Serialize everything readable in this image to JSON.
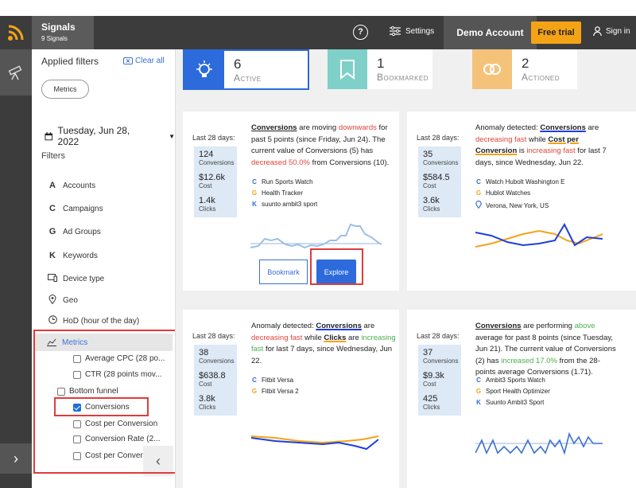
{
  "app": {
    "title": "Signals",
    "subtitle": "9 Signals"
  },
  "topbar": {
    "help": "?",
    "settings": "Settings",
    "account": "Demo Account",
    "trial": "Free trial",
    "signin": "Sign in"
  },
  "sidebar": {
    "applied_filters": "Applied filters",
    "clear_all": "Clear all",
    "pill": "Metrics",
    "date": "Tuesday, Jun 28, 2022",
    "filters_title": "Filters",
    "filters": [
      {
        "icon": "A",
        "label": "Accounts"
      },
      {
        "icon": "C",
        "label": "Campaigns"
      },
      {
        "icon": "G",
        "label": "Ad Groups"
      },
      {
        "icon": "K",
        "label": "Keywords"
      },
      {
        "icon": "device",
        "label": "Device type"
      },
      {
        "icon": "pin",
        "label": "Geo"
      },
      {
        "icon": "clock",
        "label": "HoD (hour of the day)"
      }
    ],
    "metrics": "Metrics",
    "checkboxes": [
      {
        "label": "Average CPC (28 po...",
        "checked": false
      },
      {
        "label": "CTR (28 points mov...",
        "checked": false
      },
      {
        "label": "Bottom funnel",
        "checked": false
      },
      {
        "label": "Conversions",
        "checked": true
      },
      {
        "label": "Cost per Conversion",
        "checked": false
      },
      {
        "label": "Conversion Rate (2...",
        "checked": false
      },
      {
        "label": "Cost per Conversi",
        "checked": false
      }
    ]
  },
  "stats": [
    {
      "value": "6",
      "label": "Active",
      "color": "#2d6bdc"
    },
    {
      "value": "1",
      "label": "Bookmarked",
      "color": "#7ed0c8"
    },
    {
      "value": "2",
      "label": "Actioned",
      "color": "#f5c27a"
    }
  ],
  "cards": [
    {
      "period": "Last 28 days:",
      "kpis": [
        {
          "v": "124",
          "k": "Conversions"
        },
        {
          "v": "$12.6k",
          "k": "Cost"
        },
        {
          "v": "1.4k",
          "k": "Clicks"
        }
      ],
      "t": [
        "Conversions",
        " are moving ",
        "downwards",
        " for past 5 points (since Friday, Jun 24). The current value of Conversions (5) has ",
        "decreased 50.0%",
        " from Conversions (10)."
      ],
      "items": [
        {
          "i": "C",
          "n": "Run Sports Watch"
        },
        {
          "i": "G",
          "n": "Health Tracker"
        },
        {
          "i": "K",
          "n": "suunto ambit3 sport"
        }
      ],
      "bookmark": "Bookmark",
      "explore": "Explore"
    },
    {
      "period": "Last 28 days:",
      "kpis": [
        {
          "v": "35",
          "k": "Conversions"
        },
        {
          "v": "$584.5",
          "k": "Cost"
        },
        {
          "v": "3.6k",
          "k": "Clicks"
        }
      ],
      "t": [
        "Anomaly detected: ",
        "Conversions",
        " are ",
        "decreasing fast",
        " while ",
        "Cost per Conversion",
        " is ",
        "increasing fast",
        " for last 7 days, since Wednesday, Jun 22."
      ],
      "items": [
        {
          "i": "C",
          "n": "Watch Hubolt Washington E"
        },
        {
          "i": "G",
          "n": "Hublot Watches"
        },
        {
          "i": "pin",
          "n": "Verona, New York, US"
        }
      ]
    },
    {
      "period": "Last 28 days:",
      "kpis": [
        {
          "v": "38",
          "k": "Conversions"
        },
        {
          "v": "$638.8",
          "k": "Cost"
        },
        {
          "v": "3.8k",
          "k": "Clicks"
        }
      ],
      "t": [
        "Anomaly detected: ",
        "Conversions",
        " are ",
        "decreasing fast",
        " while ",
        "Clicks",
        " are ",
        "increasing fast",
        " for last 7 days, since Wednesday, Jun 22."
      ],
      "items": [
        {
          "i": "C",
          "n": "Fitbit Versa"
        },
        {
          "i": "G",
          "n": "Fitbit Versa 2"
        }
      ]
    },
    {
      "period": "Last 28 days:",
      "kpis": [
        {
          "v": "37",
          "k": "Conversions"
        },
        {
          "v": "$9.3k",
          "k": "Cost"
        },
        {
          "v": "425",
          "k": "Clicks"
        }
      ],
      "t": [
        "Conversions",
        " are performing ",
        "above",
        " average for past 8 points (since Tuesday, Jun 21). The current value of Conversions (2) has ",
        "increased 17.0%",
        " from the 28-points average Conversions (1.71)."
      ],
      "items": [
        {
          "i": "C",
          "n": "Ambit3 Sports Watch"
        },
        {
          "i": "G",
          "n": "Sport Health Optimizer"
        },
        {
          "i": "K",
          "n": "Suunto Ambit3 Sport"
        }
      ]
    }
  ]
}
